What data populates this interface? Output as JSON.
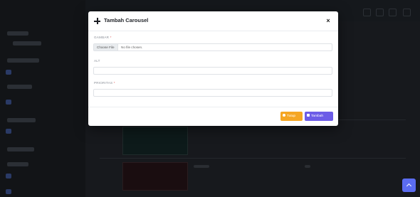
{
  "modal": {
    "title": "Tambah Carousel",
    "close_symbol": "×",
    "fields": {
      "gambar": {
        "label": "GAMBAR",
        "required_mark": "*",
        "file_button": "Choose File",
        "file_status": "No file chosen."
      },
      "alt": {
        "label": "ALT",
        "value": ""
      },
      "prioritas": {
        "label": "PRIORITAS",
        "required_mark": "*",
        "value": ""
      }
    },
    "buttons": {
      "tutup": {
        "label": "Tutup",
        "icon": "circle-x-icon",
        "color": "#f5a623"
      },
      "tambah": {
        "label": "Tambah",
        "icon": "save-icon",
        "color": "#6c5ce7"
      }
    }
  },
  "scroll_top": {
    "icon": "chevron-up-icon",
    "color": "#5b6cf0"
  }
}
